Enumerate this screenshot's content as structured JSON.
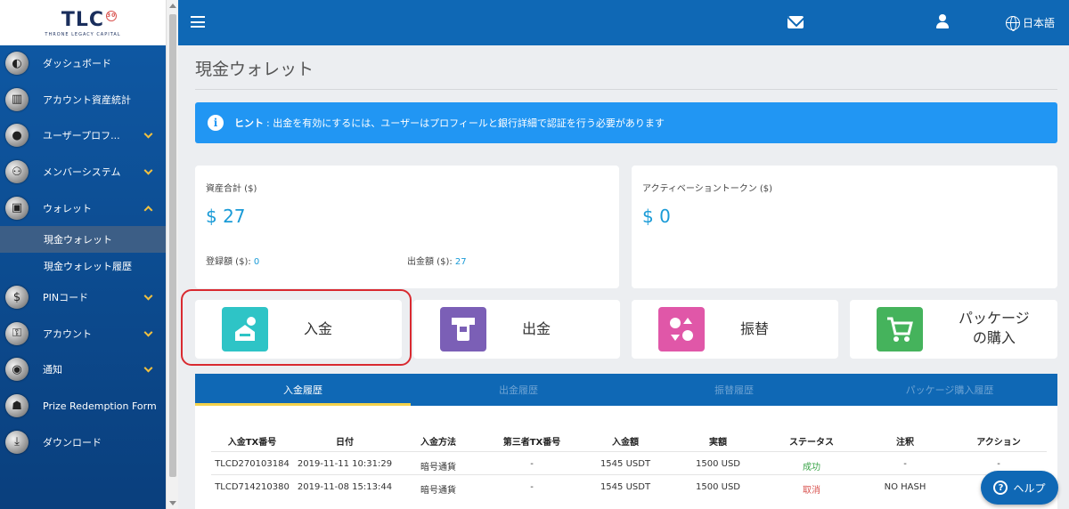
{
  "brand": {
    "logo": "TLC",
    "badge": "30",
    "tagline": "THRONE LEGACY CAPITAL"
  },
  "topbar": {
    "language": "日本語"
  },
  "sidebar": {
    "items": [
      {
        "label": "ダッシュボード",
        "icon": "dashboard-icon",
        "glyph": "◐"
      },
      {
        "label": "アカウント資産統計",
        "icon": "bar-chart-icon",
        "glyph": "▥"
      },
      {
        "label": "ユーザープロフ...",
        "icon": "user-profile-icon",
        "glyph": "●"
      },
      {
        "label": "メンバーシステム",
        "icon": "members-icon",
        "glyph": "⚇"
      },
      {
        "label": "ウォレット",
        "icon": "wallet-icon",
        "glyph": "▣"
      },
      {
        "label": "PINコード",
        "icon": "pin-shield-icon",
        "glyph": "$"
      },
      {
        "label": "アカウント",
        "icon": "lock-icon",
        "glyph": "⚿"
      },
      {
        "label": "通知",
        "icon": "notification-icon",
        "glyph": "◉"
      },
      {
        "label": "Prize Redemption Form",
        "icon": "prize-icon",
        "glyph": "☗"
      },
      {
        "label": "ダウンロード",
        "icon": "download-icon",
        "glyph": "⤓"
      }
    ],
    "wallet_sub": [
      "現金ウォレット",
      "現金ウォレット履歴"
    ]
  },
  "page": {
    "title": "現金ウォレット"
  },
  "hint": {
    "title": "ヒント",
    "text": ": 出金を有効にするには、ユーザーはプロフィールと銀行詳細で認証を行う必要があります"
  },
  "summary": {
    "total_label": "資産合計 ($)",
    "total_value": "$ 27",
    "deposited_label": "登録額 ($):",
    "deposited_value": "0",
    "withdrawn_label": "出金額 ($):",
    "withdrawn_value": "27",
    "token_label": "アクティベーショントークン ($)",
    "token_value": "$ 0"
  },
  "actions": [
    {
      "label": "入金",
      "color": "#2ec4c6"
    },
    {
      "label": "出金",
      "color": "#7b5fb6"
    },
    {
      "label": "振替",
      "color": "#e057a8"
    },
    {
      "label": "パッケージ\nの購入",
      "color": "#45b35c"
    }
  ],
  "tabs": [
    "入金履歴",
    "出金履歴",
    "振替履歴",
    "パッケージ購入履歴"
  ],
  "table": {
    "headers": [
      "入金TX番号",
      "日付",
      "入金方法",
      "第三者TX番号",
      "入金額",
      "実額",
      "ステータス",
      "注釈",
      "アクション"
    ],
    "rows": [
      [
        "TLCD270103184",
        "2019-11-11 10:31:29",
        "暗号通貨",
        "-",
        "1545 USDT",
        "1500 USD",
        "成功",
        "-",
        "-"
      ],
      [
        "TLCD714210380",
        "2019-11-08 15:13:44",
        "暗号通貨",
        "-",
        "1545 USDT",
        "1500 USD",
        "取消",
        "NO HASH",
        ""
      ]
    ],
    "status_colors": {
      "success": "#3ca54a",
      "cancel": "#d9534f"
    }
  },
  "help": {
    "label": "ヘルプ"
  }
}
